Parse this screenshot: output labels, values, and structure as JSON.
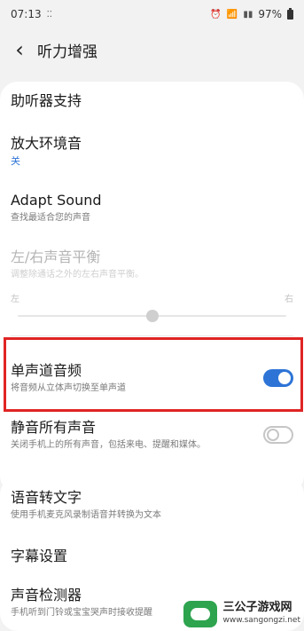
{
  "status_bar": {
    "time": "07:13",
    "notification_icons": "⁚⁚",
    "battery": "97%"
  },
  "header": {
    "title": "听力增强"
  },
  "items": {
    "hearing_aid": {
      "title": "助听器支持"
    },
    "amplify": {
      "title": "放大环境音",
      "value": "关"
    },
    "adapt_sound": {
      "title": "Adapt Sound",
      "subtitle": "查找最适合您的声音"
    },
    "balance": {
      "title": "左/右声音平衡",
      "subtitle": "调整除通话之外的左右声音平衡。",
      "left_label": "左",
      "right_label": "右",
      "level": 0.5
    },
    "mono": {
      "title": "单声道音频",
      "subtitle": "将音频从立体声切换至单声道",
      "enabled": true
    },
    "mute": {
      "title": "静音所有声音",
      "subtitle": "关闭手机上的所有声音，包括来电、提醒和媒体。",
      "enabled": false
    },
    "speech_to_text": {
      "title": "语音转文字",
      "subtitle": "使用手机麦克风录制语音并转换为文本"
    },
    "caption": {
      "title": "字幕设置"
    },
    "sound_detect": {
      "title": "声音检测器",
      "subtitle": "手机听到门铃或宝宝哭声时接收提醒"
    }
  },
  "watermark": {
    "name": "三公子游戏网",
    "url": "www.sangongzi.net"
  },
  "colors": {
    "accent": "#2e74d6",
    "highlight": "#e02424",
    "background": "#f2f2f2"
  }
}
